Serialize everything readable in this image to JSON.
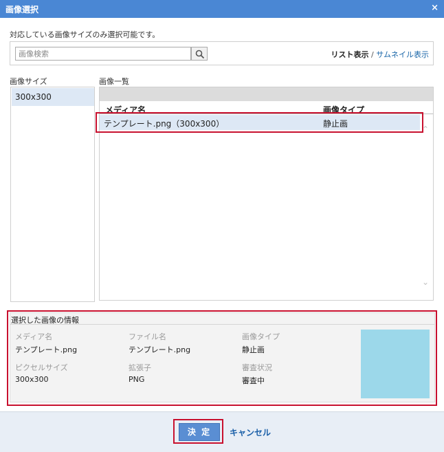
{
  "window": {
    "title": "画像選択",
    "close_glyph": "×"
  },
  "note": "対応している画像サイズのみ選択可能です。",
  "search": {
    "placeholder": "画像検索",
    "value": ""
  },
  "view_switch": {
    "list": "リスト表示",
    "separator": "/",
    "thumbnail": "サムネイル表示"
  },
  "size_panel": {
    "label": "画像サイズ",
    "items": [
      "300x300"
    ]
  },
  "image_list": {
    "label": "画像一覧",
    "columns": [
      "メディア名",
      "画像タイプ"
    ],
    "rows": [
      {
        "media_name": "テンプレート.png（300x300）",
        "type": "静止画"
      }
    ]
  },
  "info": {
    "title": "選択した画像の情報",
    "fields": [
      {
        "label": "メディア名",
        "value": "テンプレート.png"
      },
      {
        "label": "ファイル名",
        "value": "テンプレート.png"
      },
      {
        "label": "画像タイプ",
        "value": "静止画"
      },
      {
        "label": "ピクセルサイズ",
        "value": "300x300"
      },
      {
        "label": "拡張子",
        "value": "PNG"
      },
      {
        "label": "審査状況",
        "value": "審査中"
      }
    ],
    "thumbnail_color": "#9cd8ea"
  },
  "footer": {
    "ok": "決 定",
    "cancel": "キャンセル"
  },
  "colors": {
    "titlebar": "#4a87d4",
    "highlight": "#c8102e",
    "selected": "#dde8f5",
    "link": "#1a66a8"
  }
}
